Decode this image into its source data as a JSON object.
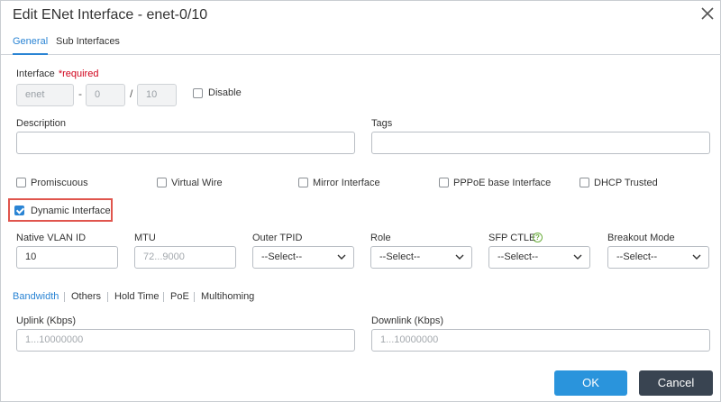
{
  "dialog": {
    "title": "Edit ENet Interface - enet-0/10"
  },
  "tabs": [
    {
      "label": "General",
      "active": true
    },
    {
      "label": "Sub Interfaces",
      "active": false
    }
  ],
  "interface": {
    "label": "Interface",
    "required": "*required",
    "type": "enet",
    "sep1": "-",
    "slot": "0",
    "sep2": "/",
    "port": "10",
    "disable_label": "Disable",
    "disable_checked": false
  },
  "description": {
    "label": "Description",
    "value": ""
  },
  "tags": {
    "label": "Tags",
    "value": ""
  },
  "checkboxes": [
    {
      "label": "Promiscuous",
      "checked": false
    },
    {
      "label": "Virtual Wire",
      "checked": false
    },
    {
      "label": "Mirror Interface",
      "checked": false
    },
    {
      "label": "PPPoE base Interface",
      "checked": false
    },
    {
      "label": "DHCP Trusted",
      "checked": false
    }
  ],
  "dynamic_interface": {
    "label": "Dynamic Interface",
    "checked": true
  },
  "fields": {
    "native_vlan": {
      "label": "Native VLAN ID",
      "value": "10"
    },
    "mtu": {
      "label": "MTU",
      "placeholder": "72...9000"
    },
    "outer_tpid": {
      "label": "Outer TPID",
      "value": "--Select--"
    },
    "role": {
      "label": "Role",
      "value": "--Select--"
    },
    "sfp_ctle": {
      "label": "SFP CTLE",
      "help": "?",
      "value": "--Select--"
    },
    "breakout_mode": {
      "label": "Breakout Mode",
      "value": "--Select--"
    }
  },
  "subtabs": [
    {
      "label": "Bandwidth",
      "active": true
    },
    {
      "label": "Others",
      "active": false
    },
    {
      "label": "Hold Time",
      "active": false
    },
    {
      "label": "PoE",
      "active": false
    },
    {
      "label": "Multihoming",
      "active": false
    }
  ],
  "uplink": {
    "label": "Uplink (Kbps)",
    "placeholder": "1...10000000"
  },
  "downlink": {
    "label": "Downlink (Kbps)",
    "placeholder": "1...10000000"
  },
  "buttons": {
    "ok": "OK",
    "cancel": "Cancel"
  },
  "colors": {
    "accent": "#2a84d4",
    "highlight": "#e0554d",
    "required": "#d0021b",
    "cancel_bg": "#394451"
  },
  "icons": {
    "close": "close-icon",
    "chevron": "chevron-down-icon",
    "help": "help-icon"
  }
}
